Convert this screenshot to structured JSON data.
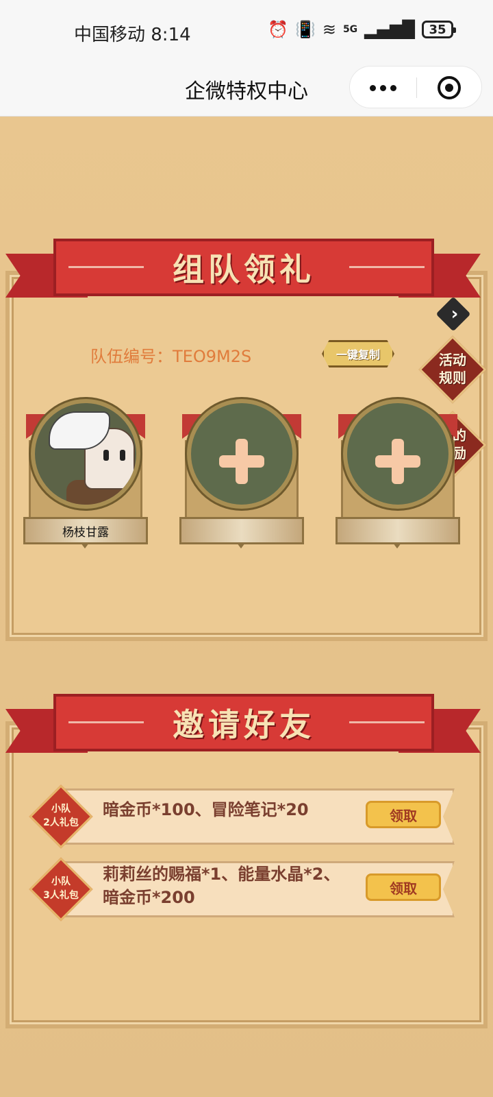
{
  "status": {
    "carrier_time": "中国移动 8:14",
    "network": "5G",
    "battery": "35"
  },
  "header": {
    "title": "企微特权中心"
  },
  "team_section": {
    "title": "组队领礼",
    "team_id": "队伍编号：TEO9M2S",
    "copy_label": "一键复制",
    "rules_label": "活动规则",
    "my_rewards_label": "我的奖励",
    "members": [
      {
        "name": "杨枝甘露"
      },
      {
        "name": ""
      },
      {
        "name": ""
      }
    ]
  },
  "invite_section": {
    "title": "邀请好友",
    "rewards": [
      {
        "badge": "小队\n2人礼包",
        "badge_l1": "小队",
        "badge_l2": "2人礼包",
        "desc": "暗金币*100、冒险笔记*20",
        "claim_label": "领取"
      },
      {
        "badge_l1": "小队",
        "badge_l2": "3人礼包",
        "desc_l1": "莉莉丝的赐福*1、能量水晶*2、",
        "desc_l2": "暗金币*200",
        "claim_label": "领取"
      }
    ]
  },
  "colors": {
    "ribbon": "#d73a36",
    "team_id_text": "#e07c3c",
    "claim_button": "#f3c24c"
  }
}
